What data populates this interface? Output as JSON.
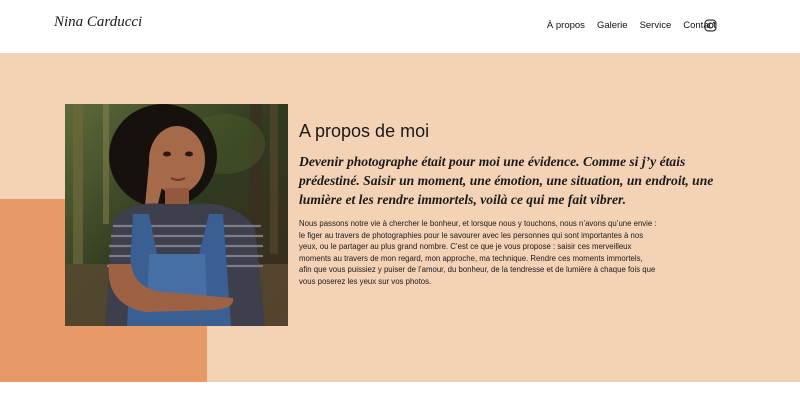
{
  "header": {
    "brand": "Nina Carducci",
    "nav": [
      {
        "label": "À propos"
      },
      {
        "label": "Galerie"
      },
      {
        "label": "Service"
      },
      {
        "label": "Contact"
      }
    ],
    "social_icon": "instagram-icon"
  },
  "about": {
    "heading": "A propos de moi",
    "quote": "Devenir photographe était pour moi une évidence. Comme si j’y étais prédestiné. Saisir un moment, une émotion, une situation, un endroit, une lumière et les rendre immortels, voilà ce qui me fait vibrer.",
    "body": "Nous passons notre vie à chercher le bonheur, et lorsque nous y touchons, nous n’avons qu’une envie : le figer au travers de photographies pour le savourer avec les personnes qui sont importantes à nos yeux, ou le partager au plus grand nombre. C’est ce que je vous propose : saisir ces merveilleux moments au travers de mon regard, mon approche, ma technique. Rendre ces moments immortels, afin que vous puissiez y puiser de l’amour, du bonheur, de la tendresse et de lumière à chaque fois que vous poserez les yeux sur vos photos."
  },
  "colors": {
    "hero_bg": "#f4d2b6",
    "accent": "#e79a66",
    "text": "#1a1a1a"
  }
}
